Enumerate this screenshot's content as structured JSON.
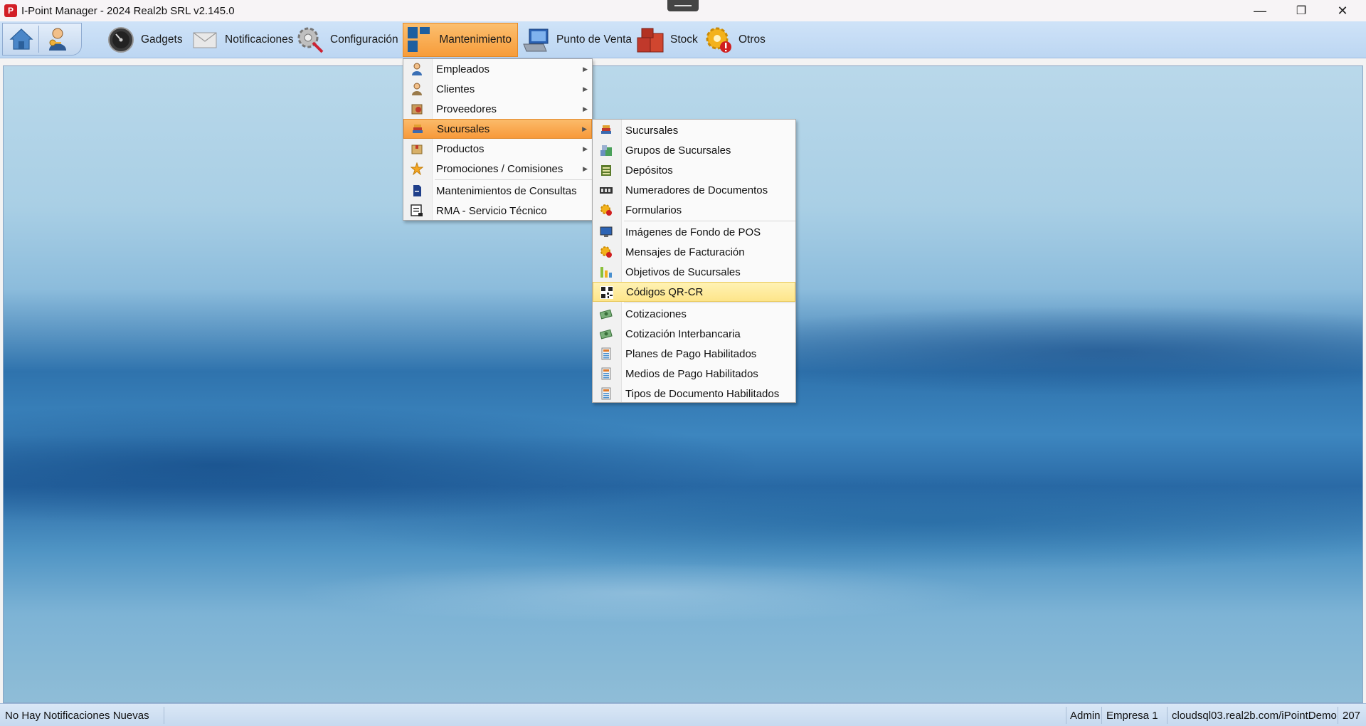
{
  "window": {
    "title": "I-Point Manager - 2024 Real2b SRL v2.145.0",
    "app_icon_letter": "P",
    "minimize": "—",
    "restore": "❐",
    "close": "✕"
  },
  "toolbar": {
    "items": [
      {
        "label": "Gadgets",
        "icon": "speedometer-icon"
      },
      {
        "label": "Notificaciones",
        "icon": "envelope-icon"
      },
      {
        "label": "Configuración",
        "icon": "gear-wrench-icon"
      },
      {
        "label": "Mantenimiento",
        "icon": "tiles-icon",
        "active": true
      },
      {
        "label": "Punto de Venta",
        "icon": "pos-monitor-icon"
      },
      {
        "label": "Stock",
        "icon": "boxes-icon"
      },
      {
        "label": "Otros",
        "icon": "gear-warning-icon"
      }
    ]
  },
  "mantenimiento_menu": {
    "items": [
      {
        "label": "Empleados",
        "submenu": true
      },
      {
        "label": "Clientes",
        "submenu": true
      },
      {
        "label": "Proveedores",
        "submenu": true
      },
      {
        "label": "Sucursales",
        "submenu": true,
        "highlighted": true
      },
      {
        "label": "Productos",
        "submenu": true
      },
      {
        "label": "Promociones / Comisiones",
        "submenu": true
      },
      {
        "label": "Mantenimientos de Consultas"
      },
      {
        "label": "RMA - Servicio Técnico"
      }
    ]
  },
  "sucursales_menu": {
    "items": [
      {
        "label": "Sucursales"
      },
      {
        "label": "Grupos de Sucursales"
      },
      {
        "label": "Depósitos"
      },
      {
        "label": "Numeradores de Documentos"
      },
      {
        "label": "Formularios"
      },
      {
        "label": "Imágenes de Fondo de POS"
      },
      {
        "label": "Mensajes de Facturación"
      },
      {
        "label": "Objetivos de Sucursales"
      },
      {
        "label": "Códigos QR-CR",
        "highlighted": true
      },
      {
        "label": "Cotizaciones"
      },
      {
        "label": "Cotización Interbancaria"
      },
      {
        "label": "Planes de Pago Habilitados"
      },
      {
        "label": "Medios de Pago Habilitados"
      },
      {
        "label": "Tipos de Documento Habilitados"
      }
    ]
  },
  "statusbar": {
    "notifications": "No Hay Notificaciones Nuevas",
    "user": "Admin",
    "company": "Empresa 1",
    "server": "cloudsql03.real2b.com/iPointDemo",
    "extra": "207"
  },
  "colors": {
    "accent_orange": "#f79c3a",
    "highlight_yellow": "#fde58a",
    "toolbar_blue": "#c4dbf4"
  }
}
